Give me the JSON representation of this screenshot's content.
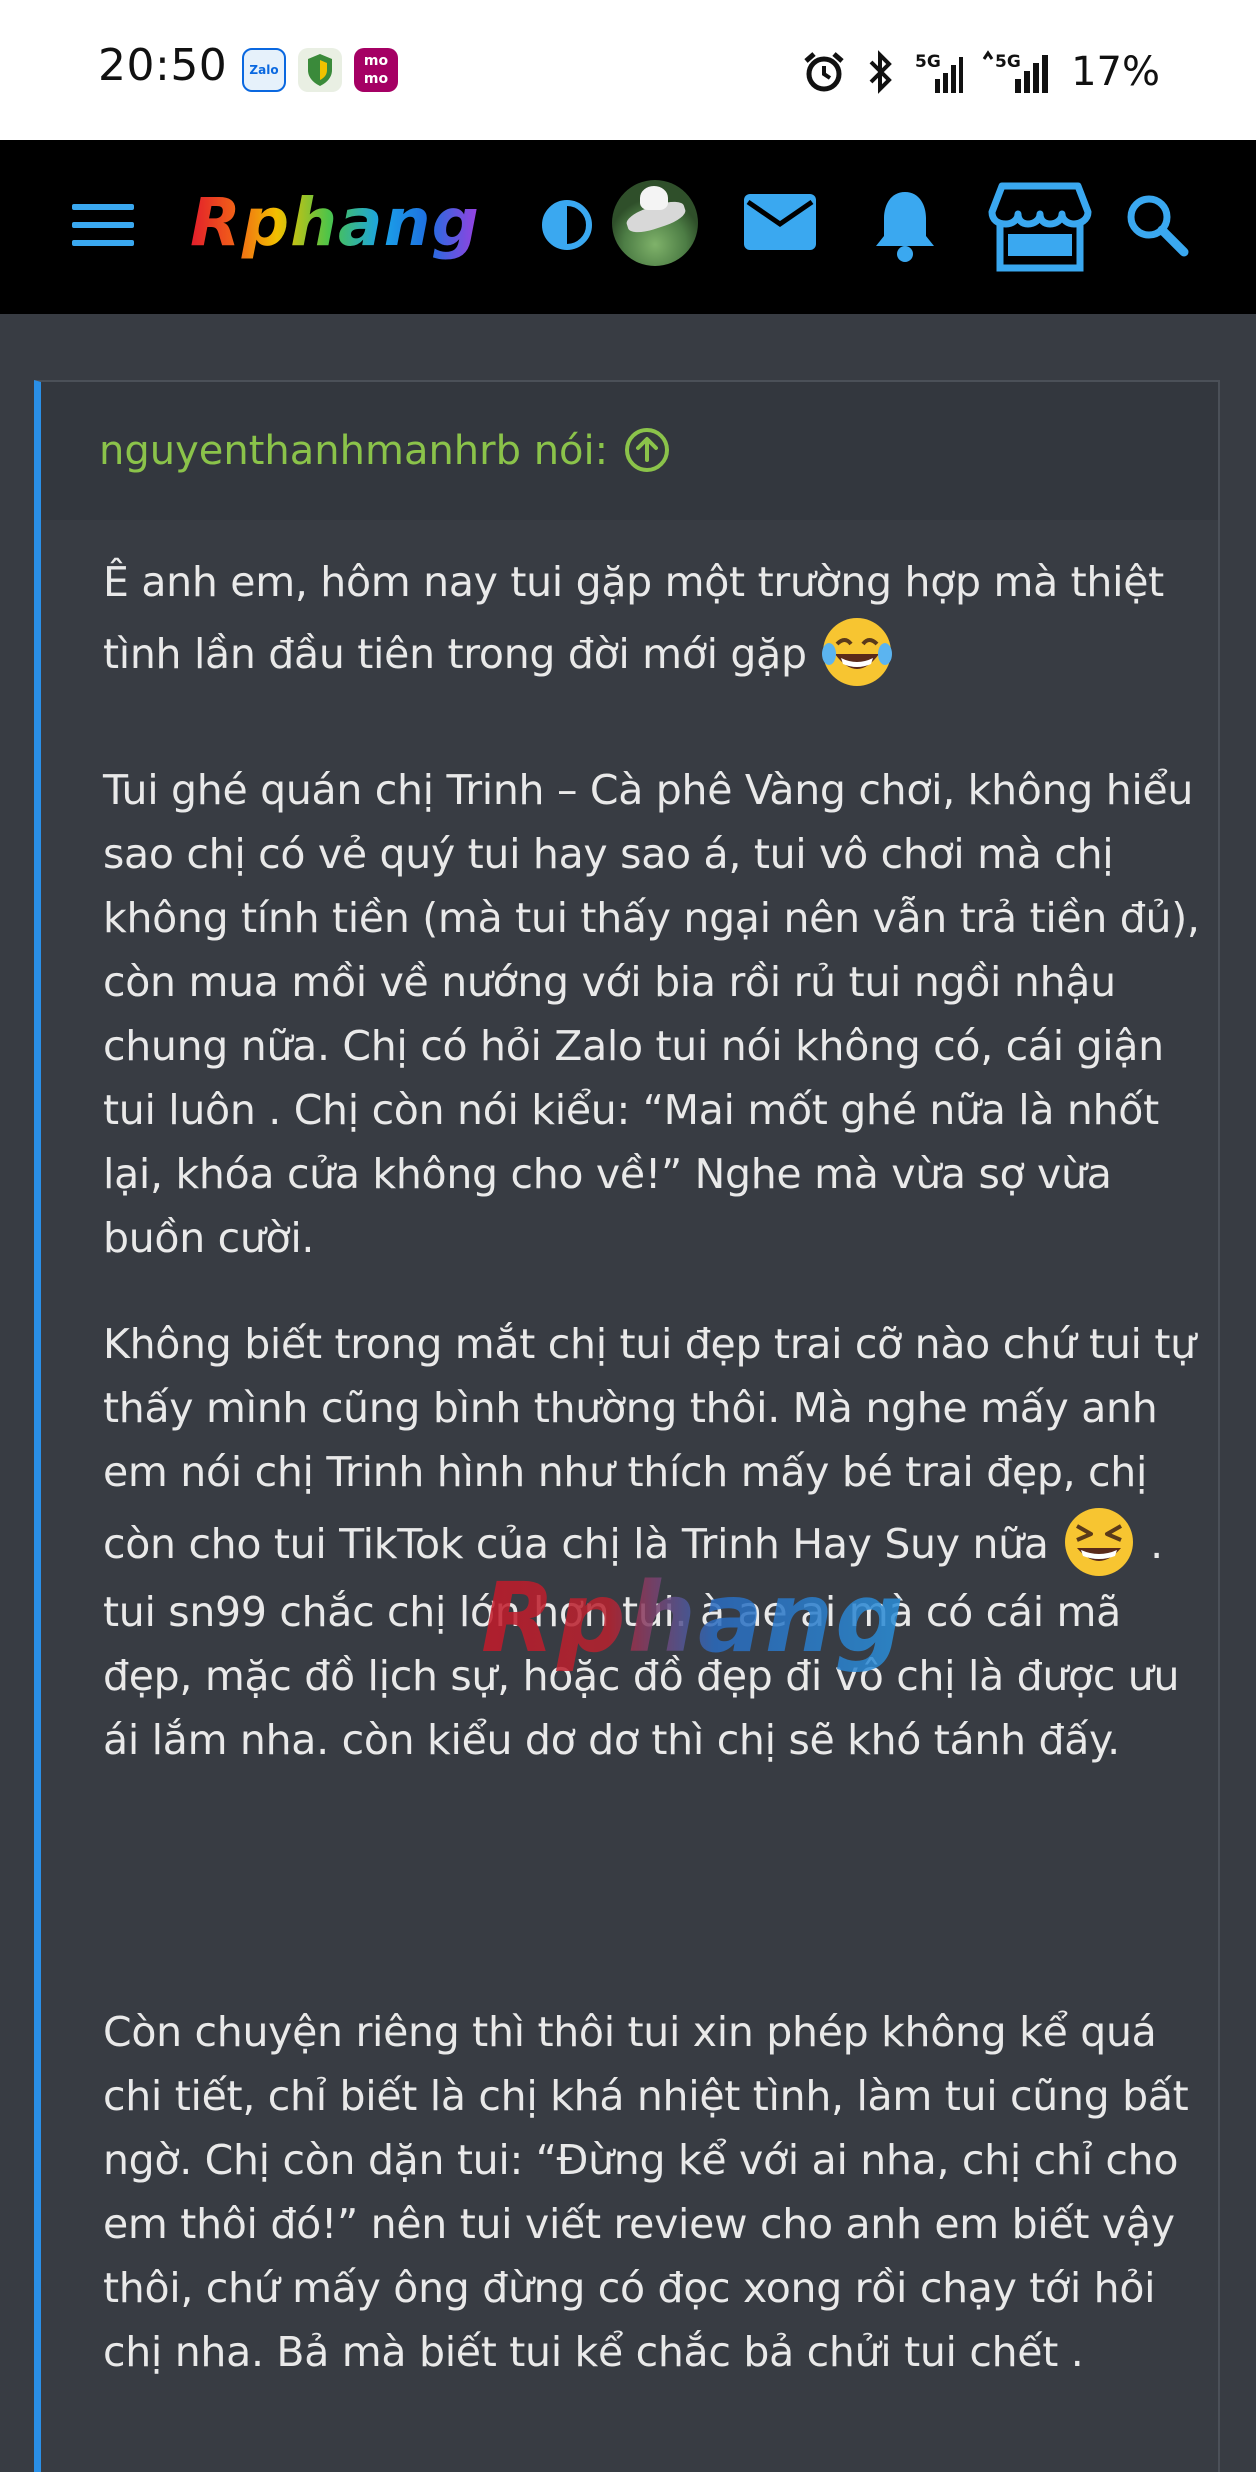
{
  "status_bar": {
    "time": "20:50",
    "apps": [
      "Zalo",
      "shield",
      "momo"
    ],
    "zalo_label": "Zalo",
    "momo_label": "mo mo",
    "battery": "17%",
    "network": "5G"
  },
  "navbar": {
    "logo": "Rphang",
    "icons": [
      "menu-icon",
      "contrast-icon",
      "avatar",
      "mail-icon",
      "bell-icon",
      "store-icon",
      "search-icon"
    ],
    "accent": "#3aa8f0"
  },
  "quote": {
    "author_line": "nguyenthanhmanhrb nói:",
    "paragraphs": [
      "Ê anh em, hôm nay tui gặp một trường hợp mà thiệt tình lần đầu tiên trong đời mới gặp",
      "Tui ghé quán chị Trinh – Cà phê Vàng chơi, không hiểu sao chị có vẻ quý tui hay sao á, tui vô chơi mà chị không tính tiền (mà tui thấy ngại nên vẫn trả tiền đủ), còn mua mồi về nướng với bia rồi rủ tui ngồi nhậu chung nữa. Chị có hỏi Zalo tui nói không có, cái giận tui luôn . Chị còn nói kiểu: “Mai mốt ghé nữa là nhốt lại, khóa cửa không cho về!” Nghe mà vừa sợ vừa buồn cười.",
      "Không biết trong mắt chị tui đẹp trai cỡ nào chứ tui tự thấy mình cũng bình thường thôi. Mà nghe mấy anh em nói chị Trinh hình như thích mấy bé trai đẹp, chị còn cho tui TikTok của chị là Trinh Hay Suy nữa",
      ". tui sn99 chắc chị lớn hơn tui. à ae ai mà có cái mã đẹp, mặc đồ lịch sự, hoặc đồ đẹp đi vô chị là được ưu ái lắm nha. còn kiểu dơ dơ thì chị sẽ khó tánh đấy.",
      "Còn chuyện riêng thì thôi tui xin phép không kể quá chi tiết, chỉ biết là chị khá nhiệt tình, làm tui cũng bất ngờ. Chị còn dặn tui: “Đừng kể với ai nha, chị chỉ cho em thôi đó!” nên tui viết review cho anh em biết vậy thôi, chứ mấy ông đừng có đọc xong rồi chạy tới hỏi chị nha. Bả mà biết tui kể chắc bả chửi tui chết ."
    ],
    "emojis": [
      "tears-of-joy-emoji",
      "grinning-squinting-emoji"
    ],
    "watermark": "Rphang",
    "border_color": "#2a8fe6",
    "author_color": "#8bc34a"
  }
}
